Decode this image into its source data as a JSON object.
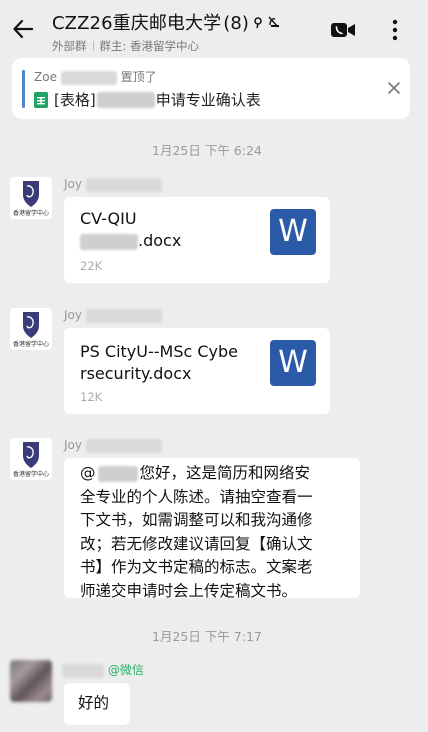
{
  "header": {
    "title": "CZZ26重庆邮电大学",
    "member_count": "(8)",
    "subtitle_left": "外部群",
    "subtitle_right": "群主: 香港留学中心"
  },
  "pinned": {
    "line1_name": "Zoe",
    "line1_suffix": "置顶了",
    "line2_prefix": "[表格]",
    "line2_suffix": "申请专业确认表"
  },
  "timestamps": [
    "1月25日 下午 6:24",
    "1月25日 下午 7:17"
  ],
  "messages": [
    {
      "sender": "Joy",
      "avatar_text": "香港留学中心",
      "file_line1": "CV-QIU",
      "file_line2": ".docx",
      "size": "22K",
      "file_icon": "W"
    },
    {
      "sender": "Joy",
      "avatar_text": "香港留学中心",
      "file_line1": "PS CityU--MSc Cybe",
      "file_line2": "rsecurity.docx",
      "size": "12K",
      "file_icon": "W"
    },
    {
      "sender": "Joy",
      "avatar_text": "香港留学中心",
      "mention": "@",
      "line1": "您好，这是简历和网络安",
      "line2": "全专业的个人陈述。请抽空查看一",
      "line3": "下文书，如需调整可以和我沟通修",
      "line4": "改；若无修改建议请回复【确认文",
      "line5": "书】作为文书定稿的标志。文案老",
      "line6": "师递交申请时会上传定稿文书。"
    },
    {
      "sender_tag": "@微信",
      "text": "好的"
    }
  ],
  "icons": {
    "back": "back-arrow-icon",
    "voice_off": "mute-icon",
    "video": "video-call-icon",
    "more": "more-vertical-icon",
    "sheet": "spreadsheet-icon",
    "close": "close-icon"
  },
  "colors": {
    "background": "#ededed",
    "word_blue": "#2a5aa8",
    "pin_bar": "#4a83c9",
    "wechat_green": "#2aae67"
  }
}
